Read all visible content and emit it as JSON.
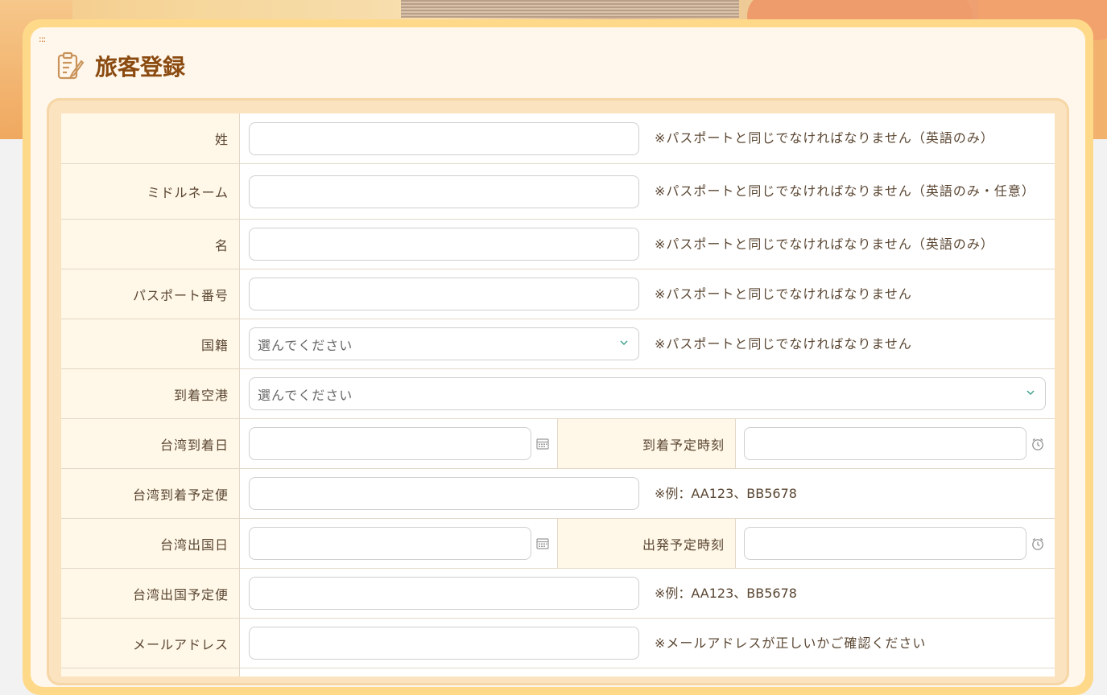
{
  "page": {
    "title": "旅客登録",
    "drag_handle": ":::"
  },
  "colors": {
    "title": "#8a4a10",
    "label_bg": "#fff7e7",
    "card_border": "#ffd98a",
    "frame": "#fbe3bf"
  },
  "icons": {
    "title": "clipboard-edit-icon",
    "date": "calendar-icon",
    "time": "clock-icon",
    "select": "chevron-down-icon"
  },
  "form": {
    "last_name": {
      "label": "姓",
      "value": "",
      "note": "※パスポートと同じでなければなりません（英語のみ）"
    },
    "middle_name": {
      "label": "ミドルネーム",
      "value": "",
      "note": "※パスポートと同じでなければなりません（英語のみ・任意）"
    },
    "first_name": {
      "label": "名",
      "value": "",
      "note": "※パスポートと同じでなければなりません（英語のみ）"
    },
    "passport": {
      "label": "パスポート番号",
      "value": "",
      "note": "※パスポートと同じでなければなりません"
    },
    "nationality": {
      "label": "国籍",
      "selected": "選んでください",
      "note": "※パスポートと同じでなければなりません"
    },
    "arrival_airport": {
      "label": "到着空港",
      "selected": "選んでください"
    },
    "arrival_date": {
      "label": "台湾到着日",
      "value": ""
    },
    "arrival_time": {
      "label": "到着予定時刻",
      "value": ""
    },
    "arrival_flight": {
      "label": "台湾到着予定便",
      "value": "",
      "note": "※例：AA123、BB5678"
    },
    "departure_date": {
      "label": "台湾出国日",
      "value": ""
    },
    "departure_time": {
      "label": "出発予定時刻",
      "value": ""
    },
    "departure_flight": {
      "label": "台湾出国予定便",
      "value": "",
      "note": "※例：AA123、BB5678"
    },
    "email": {
      "label": "メールアドレス",
      "value": "",
      "note": "※メールアドレスが正しいかご確認ください"
    }
  }
}
